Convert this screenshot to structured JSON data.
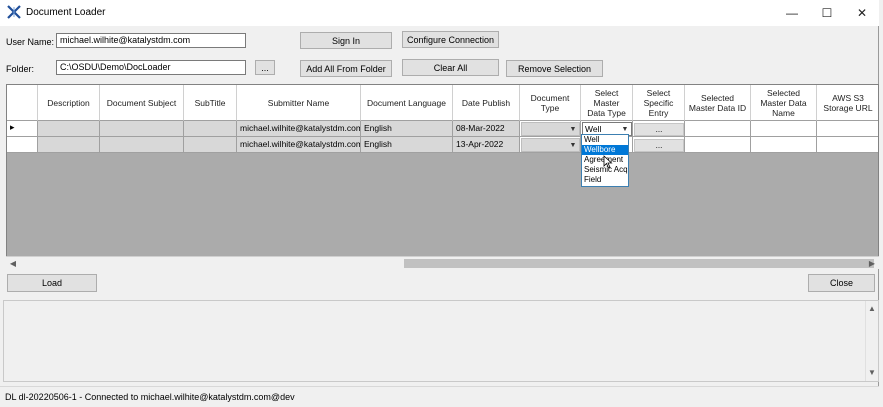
{
  "window": {
    "title": "Document Loader"
  },
  "form": {
    "user_name_label": "User Name:",
    "user_name_value": "michael.wilhite@katalystdm.com",
    "folder_label": "Folder:",
    "folder_value": "C:\\OSDU\\Demo\\DocLoader",
    "browse_label": "...",
    "sign_in_label": "Sign In",
    "configure_label": "Configure Connection",
    "add_all_label": "Add All From Folder",
    "clear_all_label": "Clear All",
    "remove_label": "Remove Selection"
  },
  "grid": {
    "columns": [
      "Description",
      "Document Subject",
      "SubTitle",
      "Submitter Name",
      "Document Language",
      "Date Publish",
      "Document\nType",
      "Select\nMaster\nData Type",
      "Select\nSpecific\nEntry",
      "Selected\nMaster Data ID",
      "Selected\nMaster Data\nName",
      "AWS S3\nStorage URL"
    ],
    "rows": [
      {
        "submitter": "michael.wilhite@katalystdm.com",
        "language": "English",
        "date": "08-Mar-2022",
        "master_type": "Well",
        "entry": "...",
        "row_marker": "▸"
      },
      {
        "submitter": "michael.wilhite@katalystdm.com",
        "language": "English",
        "date": "13-Apr-2022",
        "master_type": "",
        "entry": "...",
        "row_marker": ""
      }
    ],
    "dropdown_options": [
      "Well",
      "Wellbore",
      "Agreement",
      "Seismic Acqu",
      "Field"
    ],
    "dropdown_selected": "Wellbore"
  },
  "actions": {
    "load_label": "Load",
    "close_label": "Close"
  },
  "status_text": "DL dl-20220506-1 - Connected to michael.wilhite@katalystdm.com@dev",
  "icons": {
    "app": "document-loader-icon",
    "minimize": "minimize-icon",
    "maximize": "maximize-icon",
    "close": "close-icon"
  }
}
